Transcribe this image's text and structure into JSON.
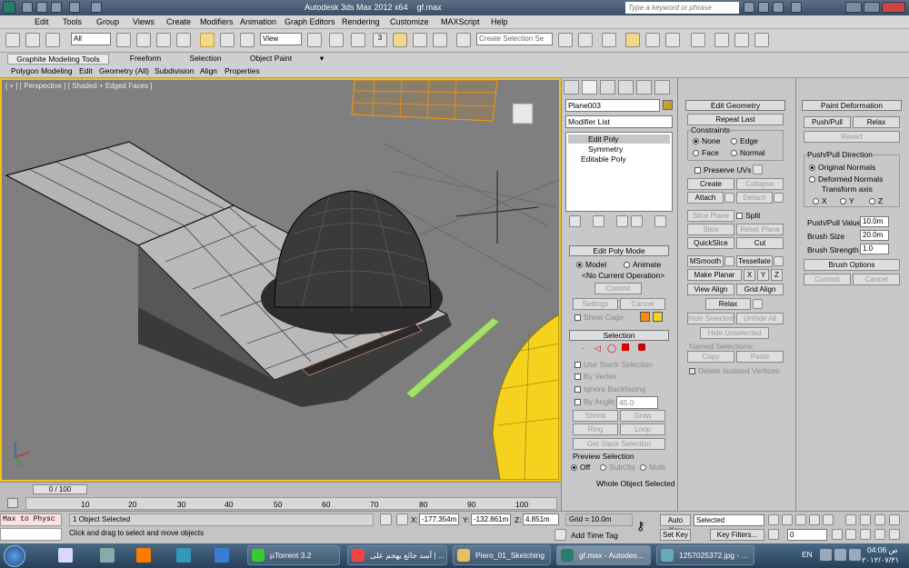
{
  "title": {
    "app": "Autodesk 3ds Max 2012 x64",
    "file": "gf.max",
    "search_placeholder": "Type a keyword or phrase"
  },
  "menu": [
    "Edit",
    "Tools",
    "Group",
    "Views",
    "Create",
    "Modifiers",
    "Animation",
    "Graph Editors",
    "Rendering",
    "Customize",
    "MAXScript",
    "Help"
  ],
  "toolbar": {
    "selection_filter": "All",
    "ref_coord": "View",
    "named_selection": "Create Selection Se",
    "snap_label": "3"
  },
  "ribbon": {
    "tabs": [
      "Graphite Modeling Tools",
      "Freeform",
      "Selection",
      "Object Paint"
    ],
    "subtabs": [
      "Polygon Modeling",
      "Edit",
      "Geometry (All)",
      "Subdivision",
      "Align",
      "Properties"
    ]
  },
  "viewport": {
    "label": "[ + ] [ Perspective ] [ Shaded + Edged Faces ]"
  },
  "command_panel": {
    "object_name": "Plane003",
    "modifier_list": "Modifier List",
    "stack": [
      "Edit Poly",
      "Symmetry",
      "Editable Poly"
    ],
    "edit_poly_mode": {
      "title": "Edit Poly Mode",
      "model": "Model",
      "animate": "Animate",
      "current_op": "<No Current Operation>",
      "commit": "Commit",
      "settings": "Settings",
      "cancel": "Cancel",
      "show_cage": "Show Cage"
    },
    "selection": {
      "title": "Selection",
      "use_stack": "Use Stack Selection",
      "by_vertex": "By Vertex",
      "ignore_backfacing": "Ignore Backfacing",
      "by_angle": "By Angle:",
      "angle_value": "45.0",
      "shrink": "Shrink",
      "grow": "Grow",
      "ring": "Ring",
      "loop": "Loop",
      "get_stack": "Get Stack Selection",
      "preview_title": "Preview Selection",
      "off": "Off",
      "subobj": "SubObj",
      "multi": "Multi",
      "whole": "Whole Object Selected"
    }
  },
  "edit_geometry": {
    "title": "Edit Geometry",
    "repeat_last": "Repeat Last",
    "constraints": "Constraints",
    "none": "None",
    "edge": "Edge",
    "face": "Face",
    "normal": "Normal",
    "preserve_uvs": "Preserve UVs",
    "create": "Create",
    "collapse": "Collapse",
    "attach": "Attach",
    "detach": "Detach",
    "slice_plane": "Slice Plane",
    "split": "Split",
    "slice": "Slice",
    "reset_plane": "Reset Plane",
    "quickslice": "QuickSlice",
    "cut": "Cut",
    "msmooth": "MSmooth",
    "tessellate": "Tessellate",
    "make_planar": "Make Planar",
    "x": "X",
    "y": "Y",
    "z": "Z",
    "view_align": "View Align",
    "grid_align": "Grid Align",
    "relax": "Relax",
    "hide_selected": "Hide Selected",
    "unhide_all": "Unhide All",
    "hide_unselected": "Hide Unselected",
    "named_selections": "Named Selections:",
    "copy": "Copy",
    "paste": "Paste",
    "delete_isolated": "Delete Isolated Vertices"
  },
  "paint_deformation": {
    "title": "Paint Deformation",
    "push_pull": "Push/Pull",
    "relax": "Relax",
    "revert": "Revert",
    "direction_title": "Push/Pull Direction",
    "original_normals": "Original Normals",
    "deformed_normals": "Deformed Normals",
    "transform_axis": "Transform axis",
    "x": "X",
    "y": "Y",
    "z": "Z",
    "push_pull_value_label": "Push/Pull Value",
    "push_pull_value": "10.0m",
    "brush_size_label": "Brush Size",
    "brush_size": "20.0m",
    "brush_strength_label": "Brush Strength",
    "brush_strength": "1.0",
    "brush_options": "Brush Options",
    "commit": "Commit",
    "cancel": "Cancel"
  },
  "timeline": {
    "frame": "0 / 100",
    "ticks": [
      "0",
      "10",
      "20",
      "30",
      "40",
      "50",
      "60",
      "70",
      "80",
      "90",
      "100"
    ]
  },
  "status": {
    "maxscript": "Max to Physc",
    "selected": "1 Object Selected",
    "prompt": "Click and drag to select and move objects",
    "x_label": "X:",
    "x": "-177.354m",
    "y_label": "Y:",
    "y": "-132.861m",
    "z_label": "Z:",
    "z": "4.851m",
    "grid": "Grid = 10.0m",
    "add_time_tag": "Add Time Tag",
    "auto_key": "Auto Key",
    "set_key": "Set Key",
    "selected_dropdown": "Selected",
    "key_filters": "Key Filters...",
    "frame_value": "0"
  },
  "taskbar": {
    "items": [
      "µTorrent 3.2",
      "أسد جائع يهجم على | ...",
      "Piero_01_Sketching",
      "gf.max - Autodes...",
      "1257025372.jpg - ..."
    ],
    "lang": "EN",
    "time": "04:06 ص",
    "date": "٢٠١٢/٠٧/٣١"
  },
  "colors": {
    "viewport_border": "#f0c020",
    "helmet_yellow": "#f4d21e",
    "orange_select": "#ff9900"
  }
}
